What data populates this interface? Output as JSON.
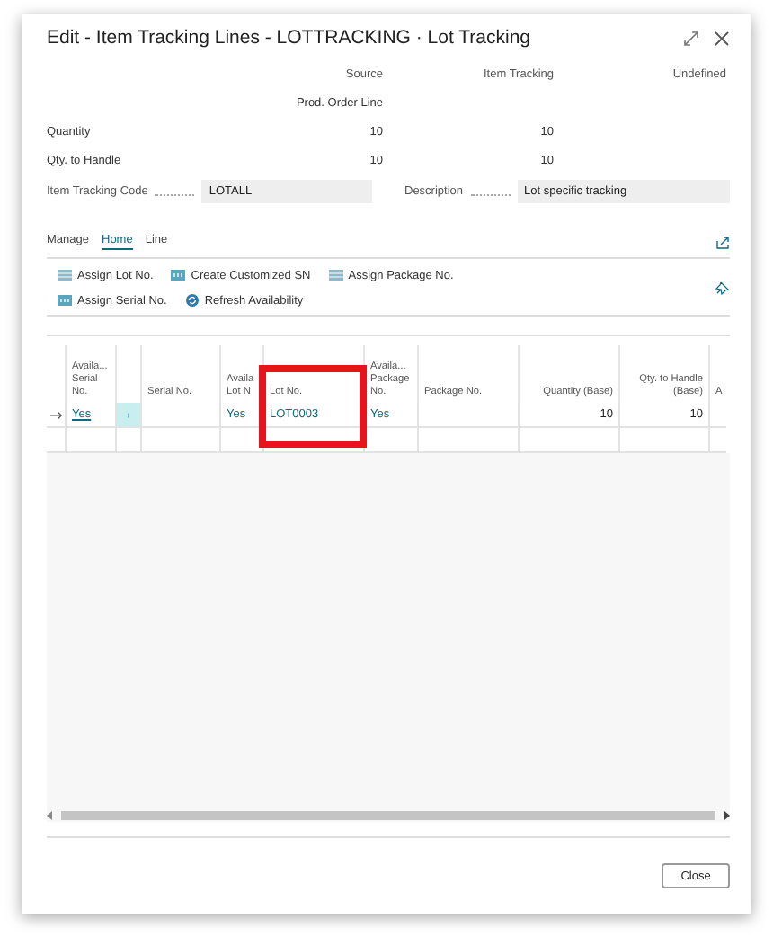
{
  "window": {
    "title": "Edit - Item Tracking Lines - LOTTRACKING · Lot Tracking"
  },
  "summary": {
    "columns": [
      "Source",
      "Item Tracking",
      "Undefined"
    ],
    "source_subtitle": "Prod. Order Line",
    "rows": [
      {
        "label": "Quantity",
        "values": [
          "10",
          "10"
        ]
      },
      {
        "label": "Qty. to Handle",
        "values": [
          "10",
          "10"
        ]
      }
    ]
  },
  "fields": [
    {
      "label": "Item Tracking Code",
      "value": "LOTALL"
    },
    {
      "label": "Description",
      "value": "Lot specific tracking"
    }
  ],
  "tabs": [
    {
      "label": "Manage",
      "selected": false
    },
    {
      "label": "Home",
      "selected": true
    },
    {
      "label": "Line",
      "selected": false
    }
  ],
  "actions": [
    [
      {
        "label": "Assign Lot No.",
        "kind": "grid"
      },
      {
        "label": "Create Customized SN",
        "kind": "tag"
      },
      {
        "label": "Assign Package No.",
        "kind": "grid"
      }
    ],
    [
      {
        "label": "Assign Serial No.",
        "kind": "tag"
      },
      {
        "label": "Refresh Availability",
        "kind": "refresh"
      }
    ]
  ],
  "table": {
    "columns": [
      {
        "label": "Availa... Serial No.",
        "kind": "text",
        "highlighted": false
      },
      {
        "kind": "menu",
        "highlighted": false
      },
      {
        "label": "Serial No.",
        "kind": "text",
        "highlighted": false
      },
      {
        "label": "Availa Lot N",
        "kind": "text",
        "highlighted": false
      },
      {
        "label": "Lot No.",
        "kind": "text",
        "highlighted": true
      },
      {
        "label": "Availa... Package No.",
        "kind": "text",
        "highlighted": false
      },
      {
        "label": "Package No.",
        "kind": "text",
        "highlighted": false
      },
      {
        "label": "Quantity (Base)",
        "kind": "number",
        "highlighted": false
      },
      {
        "label": "Qty. to Handle (Base)",
        "kind": "number",
        "highlighted": false
      },
      {
        "label": "A",
        "kind": "text",
        "highlighted": false
      }
    ],
    "rows": [
      {
        "current": true,
        "cells": [
          {
            "text": "Yes",
            "kind": "link"
          },
          {
            "kind": "menu"
          },
          {
            "kind": "blank"
          },
          {
            "text": "Yes",
            "kind": "value"
          },
          {
            "text": "LOT0003",
            "kind": "value"
          },
          {
            "text": "Yes",
            "kind": "value"
          },
          {
            "kind": "blank"
          },
          {
            "text": "10",
            "kind": "value"
          },
          {
            "text": "10",
            "kind": "value"
          },
          {
            "kind": "blank"
          }
        ]
      }
    ]
  },
  "buttons": [
    {
      "label": "Close"
    }
  ]
}
